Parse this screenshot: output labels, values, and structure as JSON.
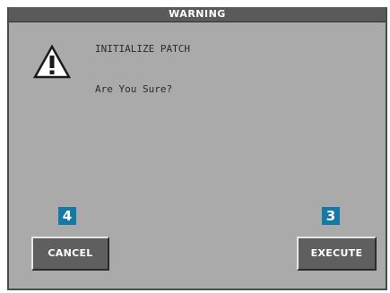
{
  "dialog": {
    "title": "WARNING",
    "icon": "warning-triangle-icon",
    "message_title": "INITIALIZE PATCH",
    "message_question": "Are You Sure?"
  },
  "buttons": {
    "cancel": {
      "label": "CANCEL",
      "shortcut": "4"
    },
    "execute": {
      "label": "EXECUTE",
      "shortcut": "3"
    }
  },
  "colors": {
    "dialog_background": "#aaaaaa",
    "title_bar": "#5a5a5a",
    "button_face": "#5f5f5f",
    "shortcut_badge": "#1579a8"
  }
}
